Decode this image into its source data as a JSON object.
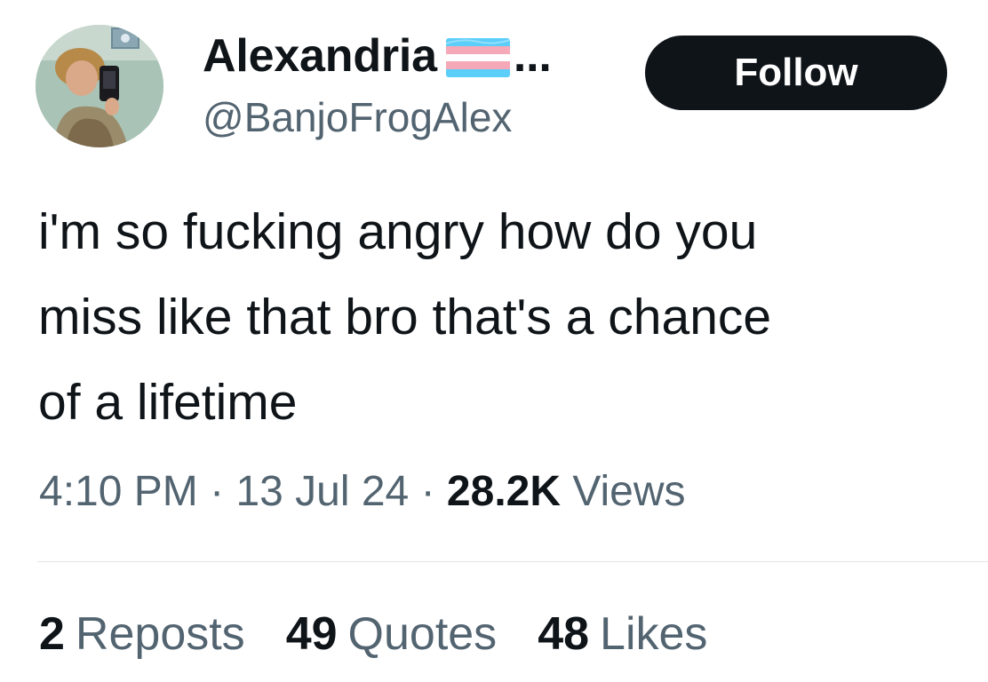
{
  "author": {
    "display_name": "Alexandria",
    "truncation": "...",
    "flag_icon": "transgender-flag-icon",
    "handle": "@BanjoFrogAlex",
    "avatar_icon": "profile-photo-avatar"
  },
  "follow_label": "Follow",
  "tweet": {
    "text": "i'm so fucking angry how do you\nmiss like that bro that's a chance\nof a lifetime"
  },
  "meta": {
    "time": "4:10 PM",
    "separator": "·",
    "date": "13 Jul 24",
    "views_count": "28.2K",
    "views_label": "Views"
  },
  "stats": {
    "reposts_count": "2",
    "reposts_label": "Reposts",
    "quotes_count": "49",
    "quotes_label": "Quotes",
    "likes_count": "48",
    "likes_label": "Likes"
  },
  "colors": {
    "text_primary": "#0f1419",
    "text_secondary": "#536471",
    "follow_bg": "#0f1419",
    "follow_text": "#ffffff",
    "flag_blue": "#5BCEFA",
    "flag_pink": "#F5A9B8",
    "flag_white": "#ffffff"
  }
}
